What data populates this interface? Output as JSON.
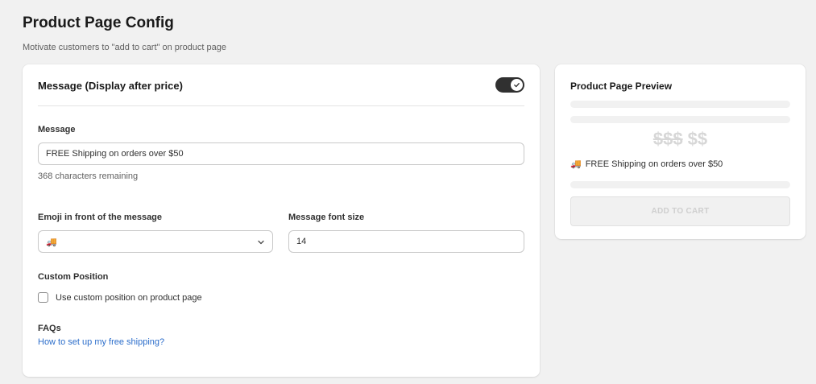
{
  "page": {
    "title": "Product Page Config",
    "subtitle": "Motivate customers to \"add to cart\" on product page"
  },
  "message_card": {
    "section_title": "Message (Display after price)",
    "toggle_on": true,
    "message_label": "Message",
    "message_value": "FREE Shipping on orders over $50",
    "chars_remaining": "368 characters remaining",
    "emoji_label": "Emoji in front of the message",
    "emoji_value": "🚚",
    "font_size_label": "Message font size",
    "font_size_value": "14",
    "custom_position_label": "Custom Position",
    "custom_position_checkbox_label": "Use custom position on product page",
    "custom_position_checked": false,
    "faqs_label": "FAQs",
    "faq_link": "How to set up my free shipping?"
  },
  "preview": {
    "title": "Product Page Preview",
    "old_price": "$$$",
    "new_price": "$$",
    "emoji": "🚚",
    "message": "FREE Shipping on orders over $50",
    "add_to_cart": "ADD TO CART"
  },
  "colors": {
    "background": "#f1f1f1",
    "toggle": "#303030",
    "link": "#2c6ecb"
  }
}
